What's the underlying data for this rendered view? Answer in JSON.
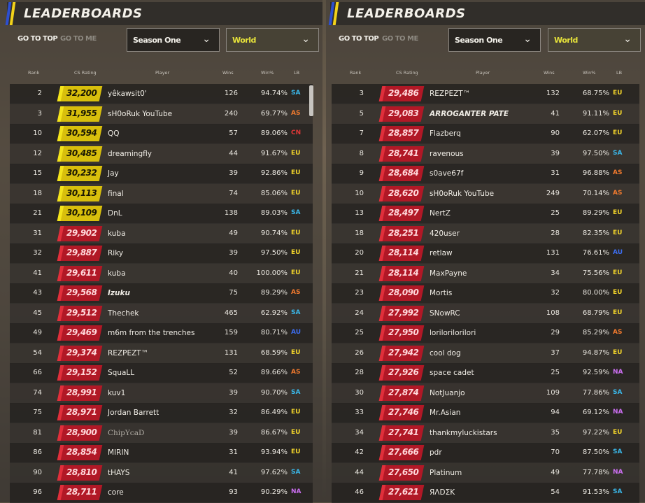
{
  "colors": {
    "SA": "#3ab8ea",
    "AS": "#f17a2e",
    "CN": "#e23838",
    "EU": "#f1d32a",
    "AU": "#3d6ef0",
    "NA": "#cc6ff2"
  },
  "panels": [
    {
      "title": "LEADERBOARDS",
      "go_to_top": "GO TO TOP",
      "go_to_me": "GO TO ME",
      "season": "Season One",
      "region": "World",
      "columns": [
        "Rank",
        "CS Rating",
        "Player",
        "Wins",
        "Win%",
        "LB"
      ],
      "rows": [
        {
          "rank": "2",
          "rating": "32,200",
          "tier": "gold",
          "player": "yêkawsit0'",
          "wins": "126",
          "pct": "94.74%",
          "lb": "SA"
        },
        {
          "rank": "3",
          "rating": "31,955",
          "tier": "gold",
          "player": "sH0oRuk YouTube",
          "wins": "240",
          "pct": "69.77%",
          "lb": "AS"
        },
        {
          "rank": "10",
          "rating": "30,594",
          "tier": "gold",
          "player": "QQ",
          "wins": "57",
          "pct": "89.06%",
          "lb": "CN"
        },
        {
          "rank": "12",
          "rating": "30,485",
          "tier": "gold",
          "player": "dreamingfly",
          "wins": "44",
          "pct": "91.67%",
          "lb": "EU"
        },
        {
          "rank": "15",
          "rating": "30,232",
          "tier": "gold",
          "player": "Jay",
          "wins": "39",
          "pct": "92.86%",
          "lb": "EU"
        },
        {
          "rank": "18",
          "rating": "30,113",
          "tier": "gold",
          "player": "final",
          "wins": "74",
          "pct": "85.06%",
          "lb": "EU"
        },
        {
          "rank": "21",
          "rating": "30,109",
          "tier": "gold",
          "player": "DnL",
          "wins": "138",
          "pct": "89.03%",
          "lb": "SA"
        },
        {
          "rank": "31",
          "rating": "29,902",
          "tier": "red",
          "player": "kuba",
          "wins": "49",
          "pct": "90.74%",
          "lb": "EU"
        },
        {
          "rank": "32",
          "rating": "29,887",
          "tier": "red",
          "player": "Riky",
          "wins": "39",
          "pct": "97.50%",
          "lb": "EU"
        },
        {
          "rank": "41",
          "rating": "29,611",
          "tier": "red",
          "player": "kuba",
          "wins": "40",
          "pct": "100.00%",
          "lb": "EU"
        },
        {
          "rank": "43",
          "rating": "29,568",
          "tier": "red",
          "player": "Izuku",
          "style": "bold",
          "wins": "75",
          "pct": "89.29%",
          "lb": "AS"
        },
        {
          "rank": "45",
          "rating": "29,512",
          "tier": "red",
          "player": "Thechek",
          "wins": "465",
          "pct": "62.92%",
          "lb": "SA"
        },
        {
          "rank": "49",
          "rating": "29,469",
          "tier": "red",
          "player": "m6m from the trenches",
          "wins": "159",
          "pct": "80.71%",
          "lb": "AU"
        },
        {
          "rank": "54",
          "rating": "29,374",
          "tier": "red",
          "player": "REZPEZT™",
          "wins": "131",
          "pct": "68.59%",
          "lb": "EU"
        },
        {
          "rank": "66",
          "rating": "29,152",
          "tier": "red",
          "player": "SquaLL",
          "wins": "52",
          "pct": "89.66%",
          "lb": "AS"
        },
        {
          "rank": "74",
          "rating": "28,991",
          "tier": "red",
          "player": "kuv1",
          "wins": "39",
          "pct": "90.70%",
          "lb": "SA"
        },
        {
          "rank": "75",
          "rating": "28,971",
          "tier": "red",
          "player": "Jordan Barrett",
          "wins": "32",
          "pct": "86.49%",
          "lb": "EU"
        },
        {
          "rank": "81",
          "rating": "28,900",
          "tier": "red",
          "player": "ChipYcaD",
          "style": "dim",
          "wins": "39",
          "pct": "86.67%",
          "lb": "EU"
        },
        {
          "rank": "86",
          "rating": "28,854",
          "tier": "red",
          "player": "MIRIN",
          "wins": "31",
          "pct": "93.94%",
          "lb": "EU"
        },
        {
          "rank": "90",
          "rating": "28,810",
          "tier": "red",
          "player": "tHAYS",
          "wins": "41",
          "pct": "97.62%",
          "lb": "SA"
        },
        {
          "rank": "96",
          "rating": "28,711",
          "tier": "red",
          "player": "core",
          "wins": "93",
          "pct": "90.29%",
          "lb": "NA"
        }
      ]
    },
    {
      "title": "LEADERBOARDS",
      "go_to_top": "GO TO TOP",
      "go_to_me": "GO TO ME",
      "season": "Season One",
      "region": "World",
      "columns": [
        "Rank",
        "CS Rating",
        "Player",
        "Wins",
        "Win%",
        "LB"
      ],
      "rows": [
        {
          "rank": "3",
          "rating": "29,486",
          "tier": "red",
          "player": "REZPEZT™",
          "wins": "132",
          "pct": "68.75%",
          "lb": "EU"
        },
        {
          "rank": "5",
          "rating": "29,083",
          "tier": "red",
          "player": "ARROGANTER PATE",
          "style": "bold",
          "wins": "41",
          "pct": "91.11%",
          "lb": "EU"
        },
        {
          "rank": "7",
          "rating": "28,857",
          "tier": "red",
          "player": "Flazberq",
          "wins": "90",
          "pct": "62.07%",
          "lb": "EU"
        },
        {
          "rank": "8",
          "rating": "28,741",
          "tier": "red",
          "player": "ravenous",
          "wins": "39",
          "pct": "97.50%",
          "lb": "SA"
        },
        {
          "rank": "9",
          "rating": "28,684",
          "tier": "red",
          "player": "s0ave67f",
          "wins": "31",
          "pct": "96.88%",
          "lb": "AS"
        },
        {
          "rank": "10",
          "rating": "28,620",
          "tier": "red",
          "player": "sH0oRuk YouTube",
          "wins": "249",
          "pct": "70.14%",
          "lb": "AS"
        },
        {
          "rank": "13",
          "rating": "28,497",
          "tier": "red",
          "player": "NertZ",
          "wins": "25",
          "pct": "89.29%",
          "lb": "EU"
        },
        {
          "rank": "18",
          "rating": "28,251",
          "tier": "red",
          "player": "420user",
          "wins": "28",
          "pct": "82.35%",
          "lb": "EU"
        },
        {
          "rank": "20",
          "rating": "28,114",
          "tier": "red",
          "player": "retlaw",
          "wins": "131",
          "pct": "76.61%",
          "lb": "AU"
        },
        {
          "rank": "21",
          "rating": "28,114",
          "tier": "red",
          "player": "MaxPayne",
          "wins": "34",
          "pct": "75.56%",
          "lb": "EU"
        },
        {
          "rank": "23",
          "rating": "28,090",
          "tier": "red",
          "player": "Mortis",
          "wins": "32",
          "pct": "80.00%",
          "lb": "EU"
        },
        {
          "rank": "24",
          "rating": "27,992",
          "tier": "red",
          "player": "SNowRC",
          "wins": "108",
          "pct": "68.79%",
          "lb": "EU"
        },
        {
          "rank": "25",
          "rating": "27,950",
          "tier": "red",
          "player": "lorilorilorilori",
          "wins": "29",
          "pct": "85.29%",
          "lb": "AS"
        },
        {
          "rank": "26",
          "rating": "27,942",
          "tier": "red",
          "player": "cool dog",
          "wins": "37",
          "pct": "94.87%",
          "lb": "EU"
        },
        {
          "rank": "28",
          "rating": "27,926",
          "tier": "red",
          "player": "space cadet",
          "wins": "25",
          "pct": "92.59%",
          "lb": "NA"
        },
        {
          "rank": "30",
          "rating": "27,874",
          "tier": "red",
          "player": "NotJuanjo",
          "wins": "109",
          "pct": "77.86%",
          "lb": "SA"
        },
        {
          "rank": "33",
          "rating": "27,746",
          "tier": "red",
          "player": "Mr.Asian",
          "wins": "94",
          "pct": "69.12%",
          "lb": "NA"
        },
        {
          "rank": "34",
          "rating": "27,741",
          "tier": "red",
          "player": "thankmyluckistars",
          "wins": "35",
          "pct": "97.22%",
          "lb": "EU"
        },
        {
          "rank": "42",
          "rating": "27,666",
          "tier": "red",
          "player": "pdr",
          "wins": "70",
          "pct": "87.50%",
          "lb": "SA"
        },
        {
          "rank": "44",
          "rating": "27,650",
          "tier": "red",
          "player": "Platinum",
          "wins": "49",
          "pct": "77.78%",
          "lb": "NA"
        },
        {
          "rank": "46",
          "rating": "27,621",
          "tier": "red",
          "player": "ЯΛDΣK",
          "wins": "54",
          "pct": "91.53%",
          "lb": "SA"
        }
      ]
    }
  ]
}
